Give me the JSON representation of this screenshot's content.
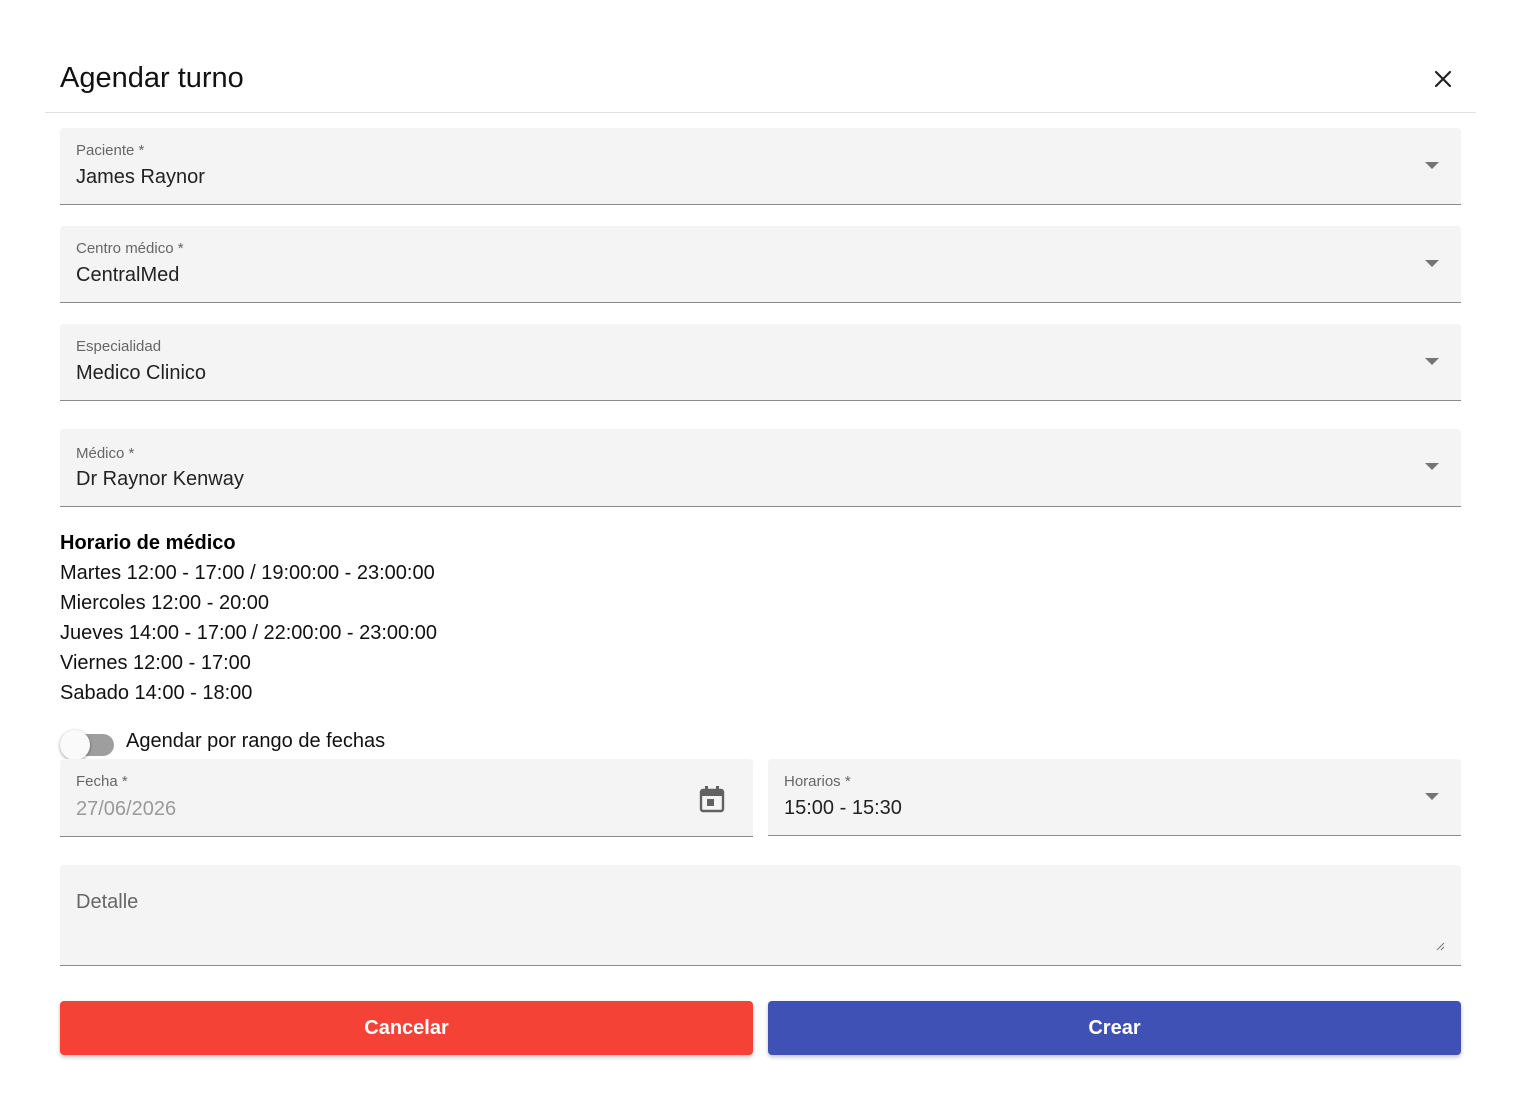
{
  "dialog": {
    "title": "Agendar turno",
    "close_icon": "close-icon"
  },
  "fields": {
    "paciente": {
      "label": "Paciente *",
      "value": "James Raynor"
    },
    "centro": {
      "label": "Centro médico *",
      "value": "CentralMed"
    },
    "especialidad": {
      "label": "Especialidad",
      "value": "Medico Clinico"
    },
    "medico": {
      "label": "Médico *",
      "value": "Dr Raynor Kenway"
    },
    "fecha": {
      "label": "Fecha *",
      "value": "27/06/2026"
    },
    "horarios": {
      "label": "Horarios *",
      "value": "15:00 - 15:30"
    },
    "detalle": {
      "placeholder": "Detalle"
    }
  },
  "schedule": {
    "title": "Horario de médico",
    "lines": [
      "Martes 12:00 - 17:00 / 19:00:00 - 23:00:00",
      "Miercoles 12:00 - 20:00",
      "Jueves 14:00 - 17:00 / 22:00:00 - 23:00:00",
      "Viernes 12:00 - 17:00",
      "Sabado 14:00 - 18:00"
    ]
  },
  "toggle": {
    "label": "Agendar por rango de fechas",
    "checked": false
  },
  "buttons": {
    "cancel": "Cancelar",
    "create": "Crear"
  },
  "colors": {
    "cancel": "#f44336",
    "create": "#3f51b5",
    "field_bg": "#f4f4f4",
    "toggle_track": "#9e9e9e"
  }
}
